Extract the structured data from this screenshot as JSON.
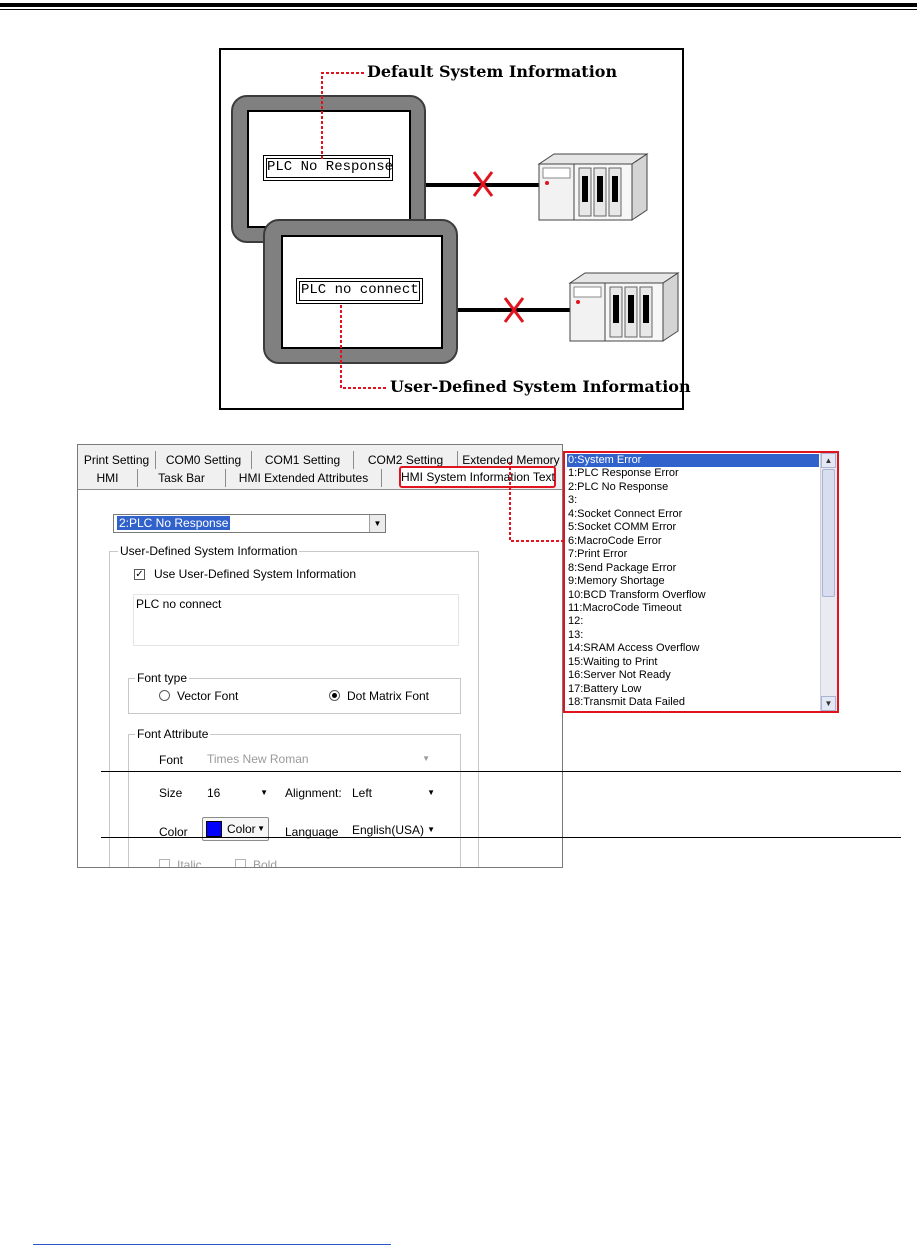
{
  "diagram": {
    "default_label": "Default System Information",
    "default_message": "PLC No Response",
    "user_label": "User-Defined System Information",
    "user_message": "PLC no connect"
  },
  "dialog": {
    "tabs_row1": [
      "Print Setting",
      "COM0 Setting",
      "COM1 Setting",
      "COM2 Setting",
      "Extended Memory"
    ],
    "tabs_row2": [
      "HMI",
      "Task Bar",
      "HMI Extended Attributes",
      "HMI System Information Text"
    ],
    "selected_message": "2:PLC No Response",
    "user_group_title": "User-Defined System Information",
    "use_user_defined_label": "Use User-Defined System Information",
    "custom_text": "PLC no connect",
    "font_type_title": "Font type",
    "vector_font_label": "Vector Font",
    "dot_matrix_font_label": "Dot Matrix Font",
    "font_attribute_title": "Font Attribute",
    "font_label": "Font",
    "font_value": "Times New Roman",
    "size_label": "Size",
    "size_value": "16",
    "alignment_label": "Alignment:",
    "alignment_value": "Left",
    "color_label": "Color",
    "color_button_label": "Color",
    "color_swatch": "#0000ff",
    "language_label": "Language",
    "language_value": "English(USA)",
    "italic_label": "Italic",
    "bold_label": "Bold"
  },
  "message_list": {
    "items": [
      "0:System Error",
      "1:PLC Response Error",
      "2:PLC No Response",
      "3:",
      "4:Socket Connect Error",
      "5:Socket COMM Error",
      "6:MacroCode Error",
      "7:Print Error",
      "8:Send Package Error",
      "9:Memory Shortage",
      "10:BCD Transform Overflow",
      "11:MacroCode Timeout",
      "12:",
      "13:",
      "14:SRAM Access Overflow",
      "15:Waiting to Print",
      "16:Server Not Ready",
      "17:Battery Low",
      "18:Transmit Data Failed"
    ],
    "selected_index": 0
  },
  "colors": {
    "highlight_red": "#e0141e",
    "selection_blue": "#3162cc"
  }
}
